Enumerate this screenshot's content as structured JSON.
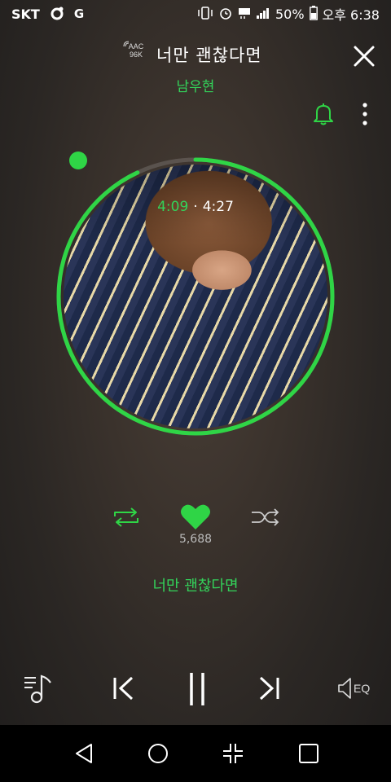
{
  "status_bar": {
    "carrier": "SKT",
    "battery": "50%",
    "time": "오후 6:38"
  },
  "header": {
    "codec_line1": "AAC",
    "codec_line2": "96K",
    "title": "너만 괜찮다면",
    "artist": "남우현"
  },
  "player": {
    "time_current": "4:09",
    "time_separator": "·",
    "time_total": "4:27",
    "progress_fraction": 0.93,
    "like_count": "5,688",
    "lyric_line": "너만 괜찮다면",
    "eq_label": "EQ"
  },
  "colors": {
    "accent": "#2fd546",
    "accent_text": "#33d35a",
    "nav_bg": "#000000"
  },
  "icons": [
    "bell-icon",
    "more-icon",
    "close-icon",
    "repeat-icon",
    "heart-icon",
    "shuffle-icon",
    "playlist-icon",
    "previous-icon",
    "pause-icon",
    "next-icon",
    "eq-icon",
    "back-icon",
    "home-icon",
    "recents-icon",
    "square-icon"
  ]
}
